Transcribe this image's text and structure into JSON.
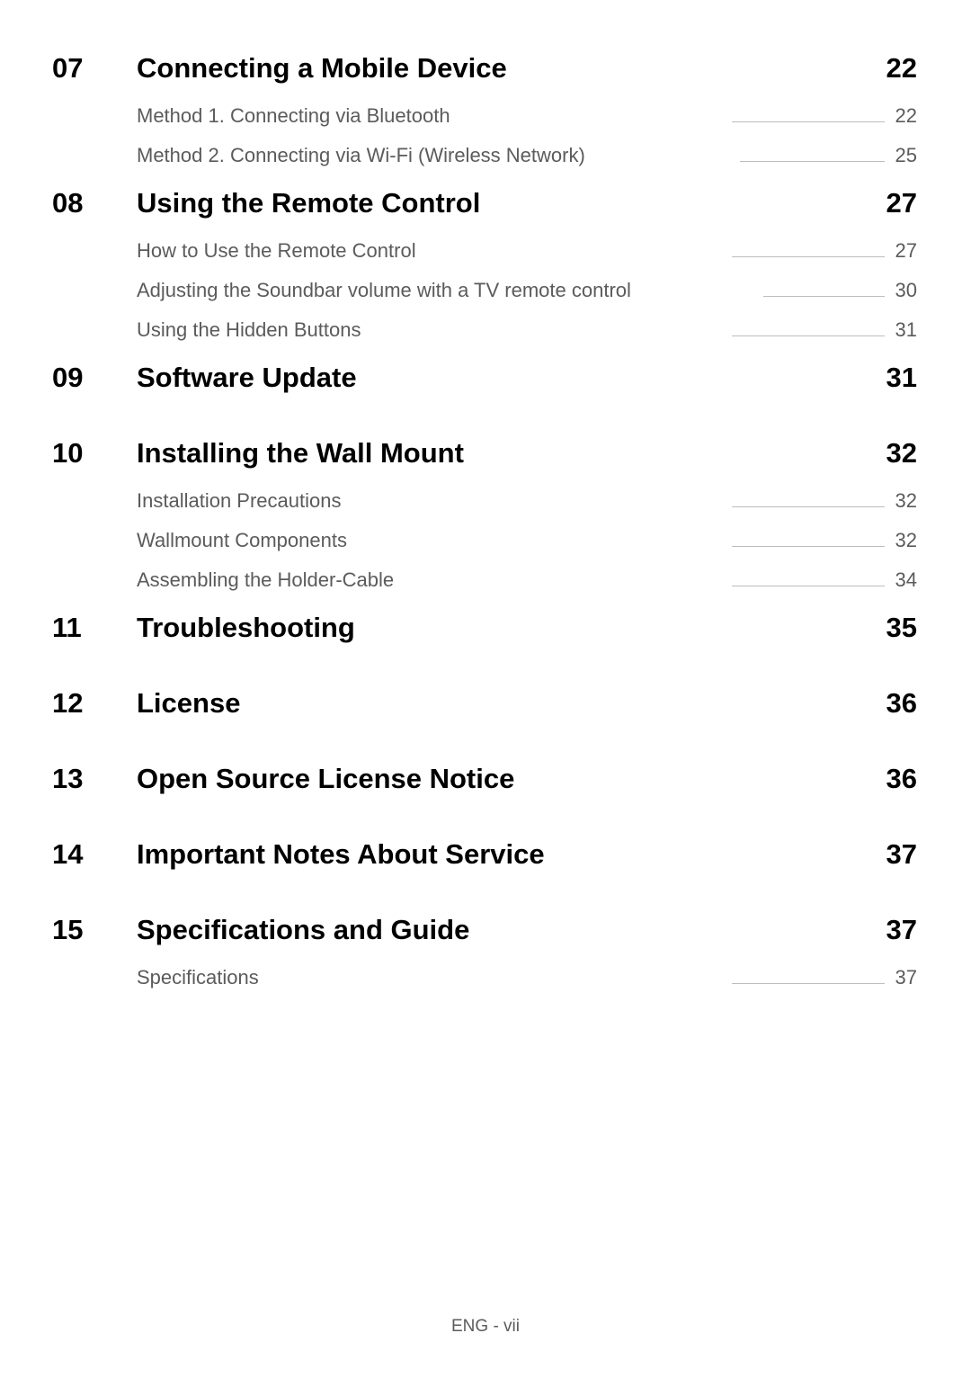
{
  "sections": [
    {
      "number": "07",
      "title": "Connecting a Mobile Device",
      "page": "22",
      "items": [
        {
          "title": "Method 1. Connecting via Bluetooth",
          "page": "22"
        },
        {
          "title": "Method 2. Connecting via Wi-Fi (Wireless Network)",
          "page": "25"
        }
      ]
    },
    {
      "number": "08",
      "title": "Using the Remote Control",
      "page": "27",
      "items": [
        {
          "title": "How to Use the Remote Control",
          "page": "27"
        },
        {
          "title": "Adjusting the Soundbar volume with a TV remote control",
          "page": "30"
        },
        {
          "title": "Using the Hidden Buttons",
          "page": "31"
        }
      ]
    },
    {
      "number": "09",
      "title": "Software Update",
      "page": "31",
      "items": []
    },
    {
      "number": "10",
      "title": "Installing the Wall Mount",
      "page": "32",
      "items": [
        {
          "title": "Installation Precautions",
          "page": "32"
        },
        {
          "title": "Wallmount Components",
          "page": "32"
        },
        {
          "title": "Assembling the Holder-Cable",
          "page": "34"
        }
      ]
    },
    {
      "number": "11",
      "title": "Troubleshooting",
      "page": "35",
      "items": []
    },
    {
      "number": "12",
      "title": "License",
      "page": "36",
      "items": []
    },
    {
      "number": "13",
      "title": "Open Source License Notice",
      "page": "36",
      "items": []
    },
    {
      "number": "14",
      "title": "Important Notes About Service",
      "page": "37",
      "items": []
    },
    {
      "number": "15",
      "title": "Specifications and Guide",
      "page": "37",
      "items": [
        {
          "title": "Specifications",
          "page": "37"
        }
      ]
    }
  ],
  "footer": "ENG - vii"
}
